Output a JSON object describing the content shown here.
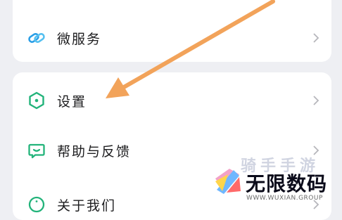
{
  "menu": {
    "top_card": {
      "items": [
        {
          "label": "微服务",
          "icon": "link-icon"
        }
      ]
    },
    "main_card": {
      "items": [
        {
          "label": "设置",
          "icon": "hexagon-settings-icon"
        },
        {
          "label": "帮助与反馈",
          "icon": "chat-feedback-icon"
        },
        {
          "label": "关于我们",
          "icon": "info-icon"
        }
      ]
    }
  },
  "colors": {
    "background": "#eeeff3",
    "card": "#ffffff",
    "accent_green": "#22b37a",
    "link_blue": "#2a9ee6",
    "annotation_arrow": "#f2a35a"
  },
  "watermark": {
    "faded_text": "骑手手游",
    "title": "无限数码",
    "subtitle": "WWW.WUXIAN.GROUP"
  }
}
